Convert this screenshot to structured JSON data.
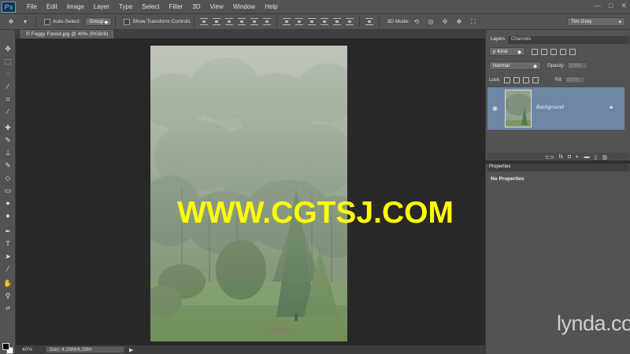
{
  "app": {
    "logo": "Ps",
    "menu": [
      "File",
      "Edit",
      "Image",
      "Layer",
      "Type",
      "Select",
      "Filter",
      "3D",
      "View",
      "Window",
      "Help"
    ],
    "window_controls": [
      "—",
      "□",
      "✕"
    ]
  },
  "options_bar": {
    "auto_select_label": "Auto-Select:",
    "auto_select_value": "Group",
    "show_transform_label": "Show Transform Controls",
    "mode_3d_label": "3D Mode:",
    "workspace_value": "Tim Grey"
  },
  "document": {
    "tab_label": "© Foggy Forest.jpg @ 40% (RGB/8)",
    "zoom": "40%",
    "doc_info": "Doc: 4.29M/4.29M"
  },
  "watermark": "WWW.CGTSJ.COM",
  "layers_panel": {
    "tabs": [
      "Layers",
      "Channels"
    ],
    "filter_kind": "ρ Kind",
    "blend_mode": "Normal",
    "opacity_label": "Opacity:",
    "opacity_value": "100%",
    "lock_label": "Lock:",
    "fill_label": "Fill:",
    "fill_value": "100%",
    "layers": [
      {
        "name": "Background",
        "visible": true,
        "locked": true
      }
    ]
  },
  "properties_panel": {
    "tab": "Properties",
    "content": "No Properties"
  },
  "branding": {
    "lynda": "lynda",
    "lynda_suffix": ".com"
  },
  "colors": {
    "chrome": "#535353",
    "workspace": "#282828",
    "selected_layer": "#6f86a5",
    "watermark": "#ffff00",
    "ps_accent": "#4aa3df"
  }
}
